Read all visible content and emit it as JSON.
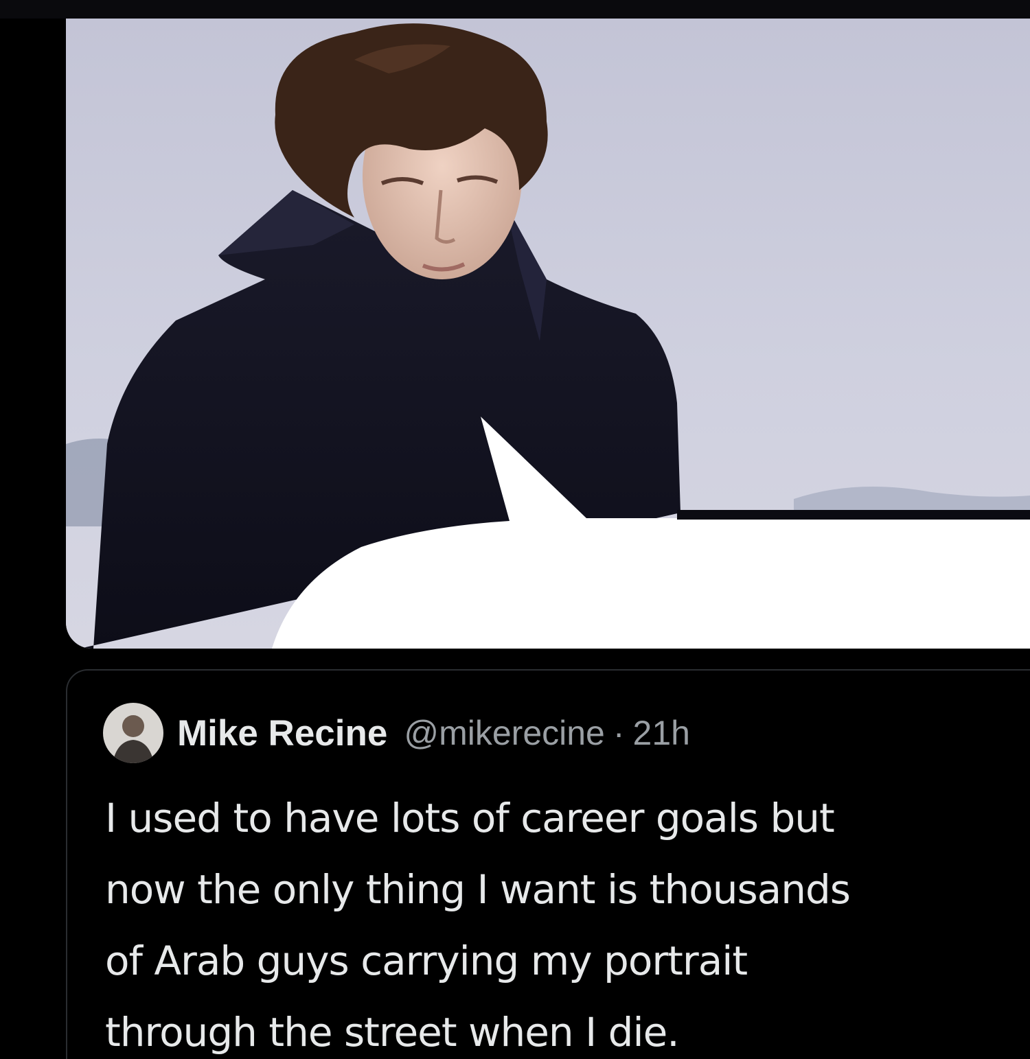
{
  "quoted_tweet": {
    "display_name": "Mike Recine",
    "handle": "@mikerecine",
    "separator": "·",
    "timestamp": "21h",
    "text_lines": [
      "I used to have lots of career goals but",
      "now the only thing I want is thousands",
      "of Arab guys carrying my portrait",
      "through the street when I die."
    ]
  },
  "media": {
    "speech_bubble_text": ""
  },
  "colors": {
    "background": "#000000",
    "text_primary": "#e7e9ea",
    "text_secondary": "#9a9fa4",
    "card_border": "#2a2d31",
    "sky": "#c7c8d8"
  }
}
